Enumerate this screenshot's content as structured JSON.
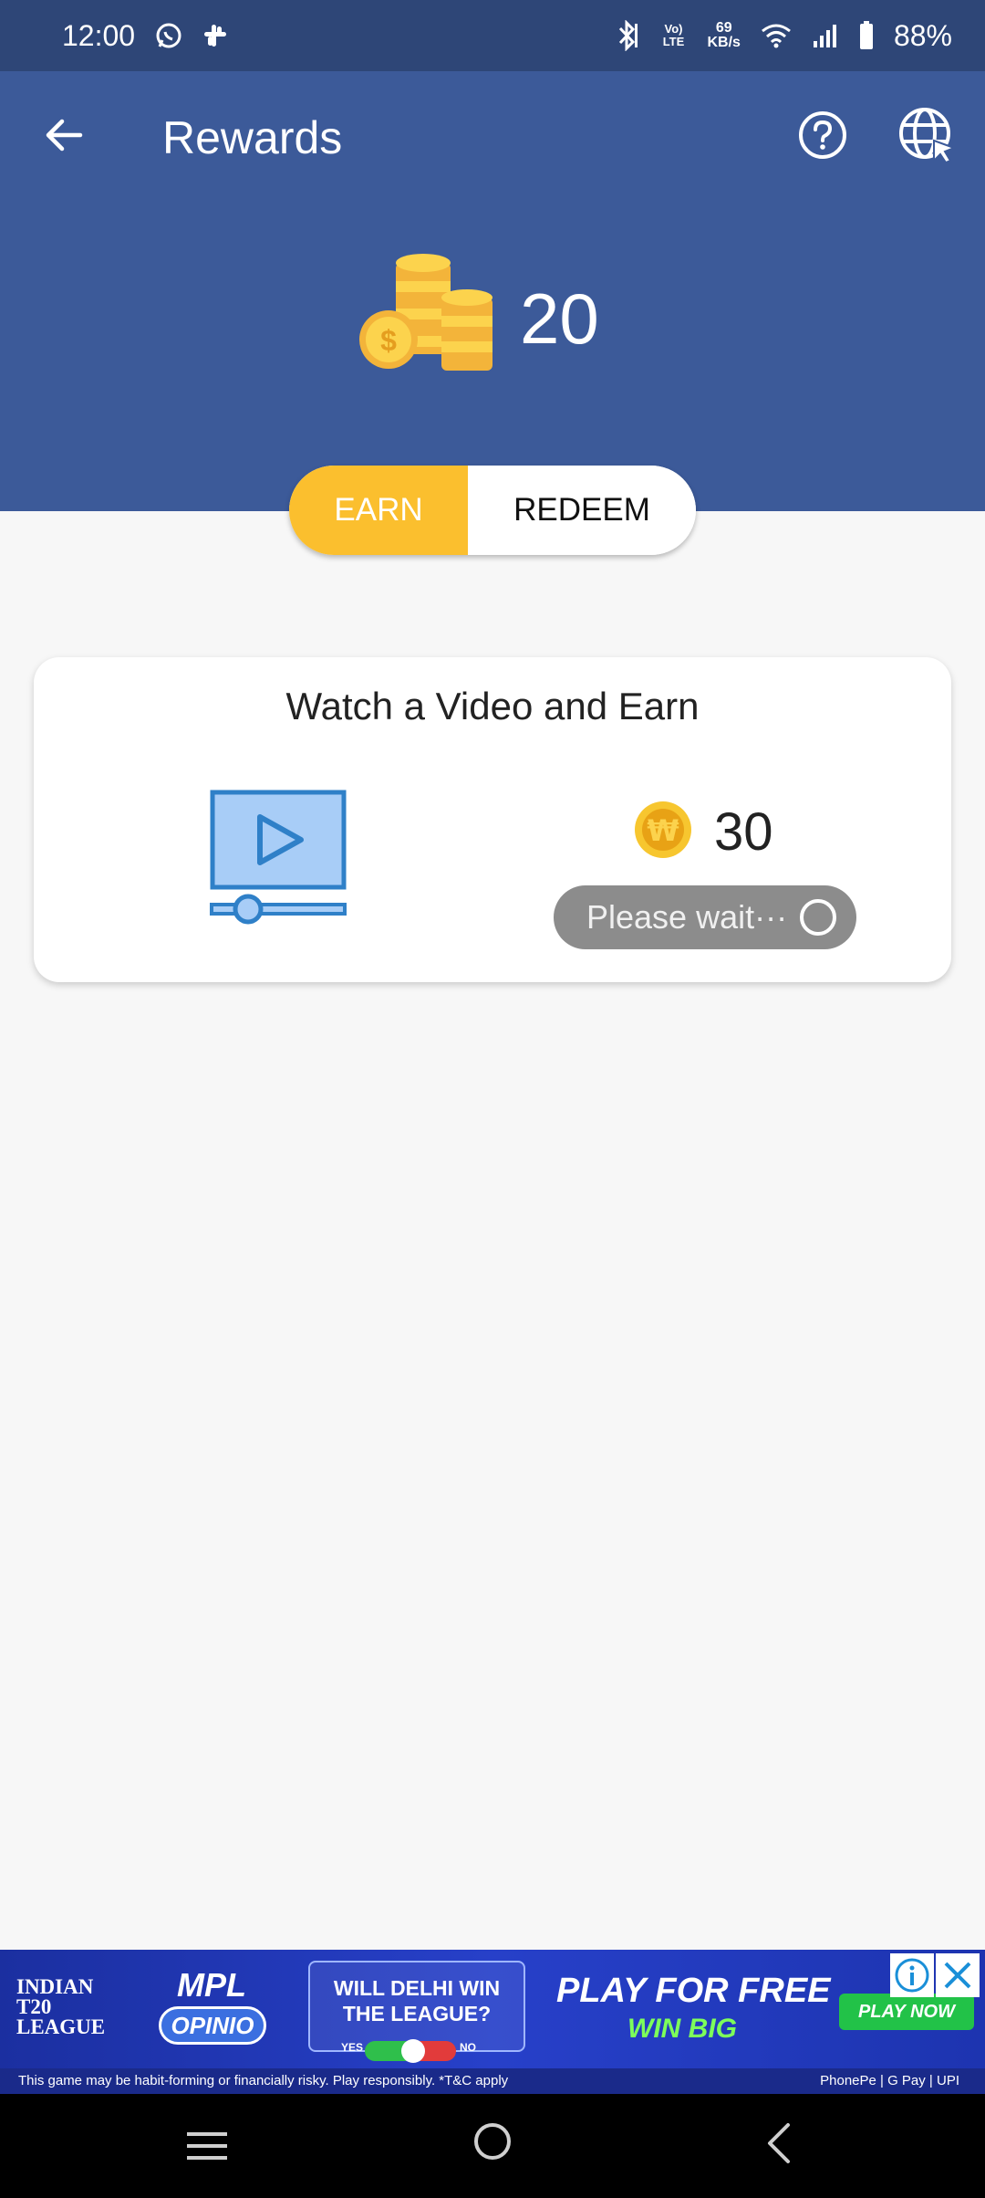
{
  "status_bar": {
    "time": "12:00",
    "net_speed_value": "69",
    "net_speed_unit": "KB/s",
    "volte_label": "Vo) LTE",
    "battery": "88%",
    "icons": [
      "whatsapp-icon",
      "slack-icon",
      "bluetooth-icon",
      "volte-icon",
      "wifi-icon",
      "signal-icon",
      "battery-icon"
    ]
  },
  "app_bar": {
    "title": "Rewards",
    "icons": [
      "back-arrow-icon",
      "help-icon",
      "globe-icon"
    ]
  },
  "balance": {
    "amount": "20",
    "icon": "coins-stack-icon"
  },
  "tabs": [
    {
      "label": "EARN",
      "active": true
    },
    {
      "label": "REDEEM",
      "active": false
    }
  ],
  "offer_card": {
    "title": "Watch a Video and Earn",
    "reward_amount": "30",
    "button_label": "Please wait···",
    "icons": [
      "video-player-icon",
      "won-coin-icon",
      "spinner-icon"
    ]
  },
  "ad_banner": {
    "league": [
      "INDIAN",
      "T20",
      "LEAGUE"
    ],
    "brand": "MPL",
    "brand_sub": "OPINIO",
    "question": "WILL DELHI WIN THE LEAGUE?",
    "yes": "YES",
    "no": "NO",
    "headline": "PLAY FOR FREE",
    "subheadline": "WIN BIG",
    "cta": "PLAY NOW",
    "disclaimer": "This game may be habit-forming or financially risky. Play responsibly. *T&C apply",
    "payments": "PhonePe | G Pay | UPI"
  },
  "colors": {
    "header_blue": "#3c5a99",
    "status_blue": "#2e4677",
    "accent_yellow": "#fbbf2e",
    "video_blue": "#2f80c8"
  }
}
